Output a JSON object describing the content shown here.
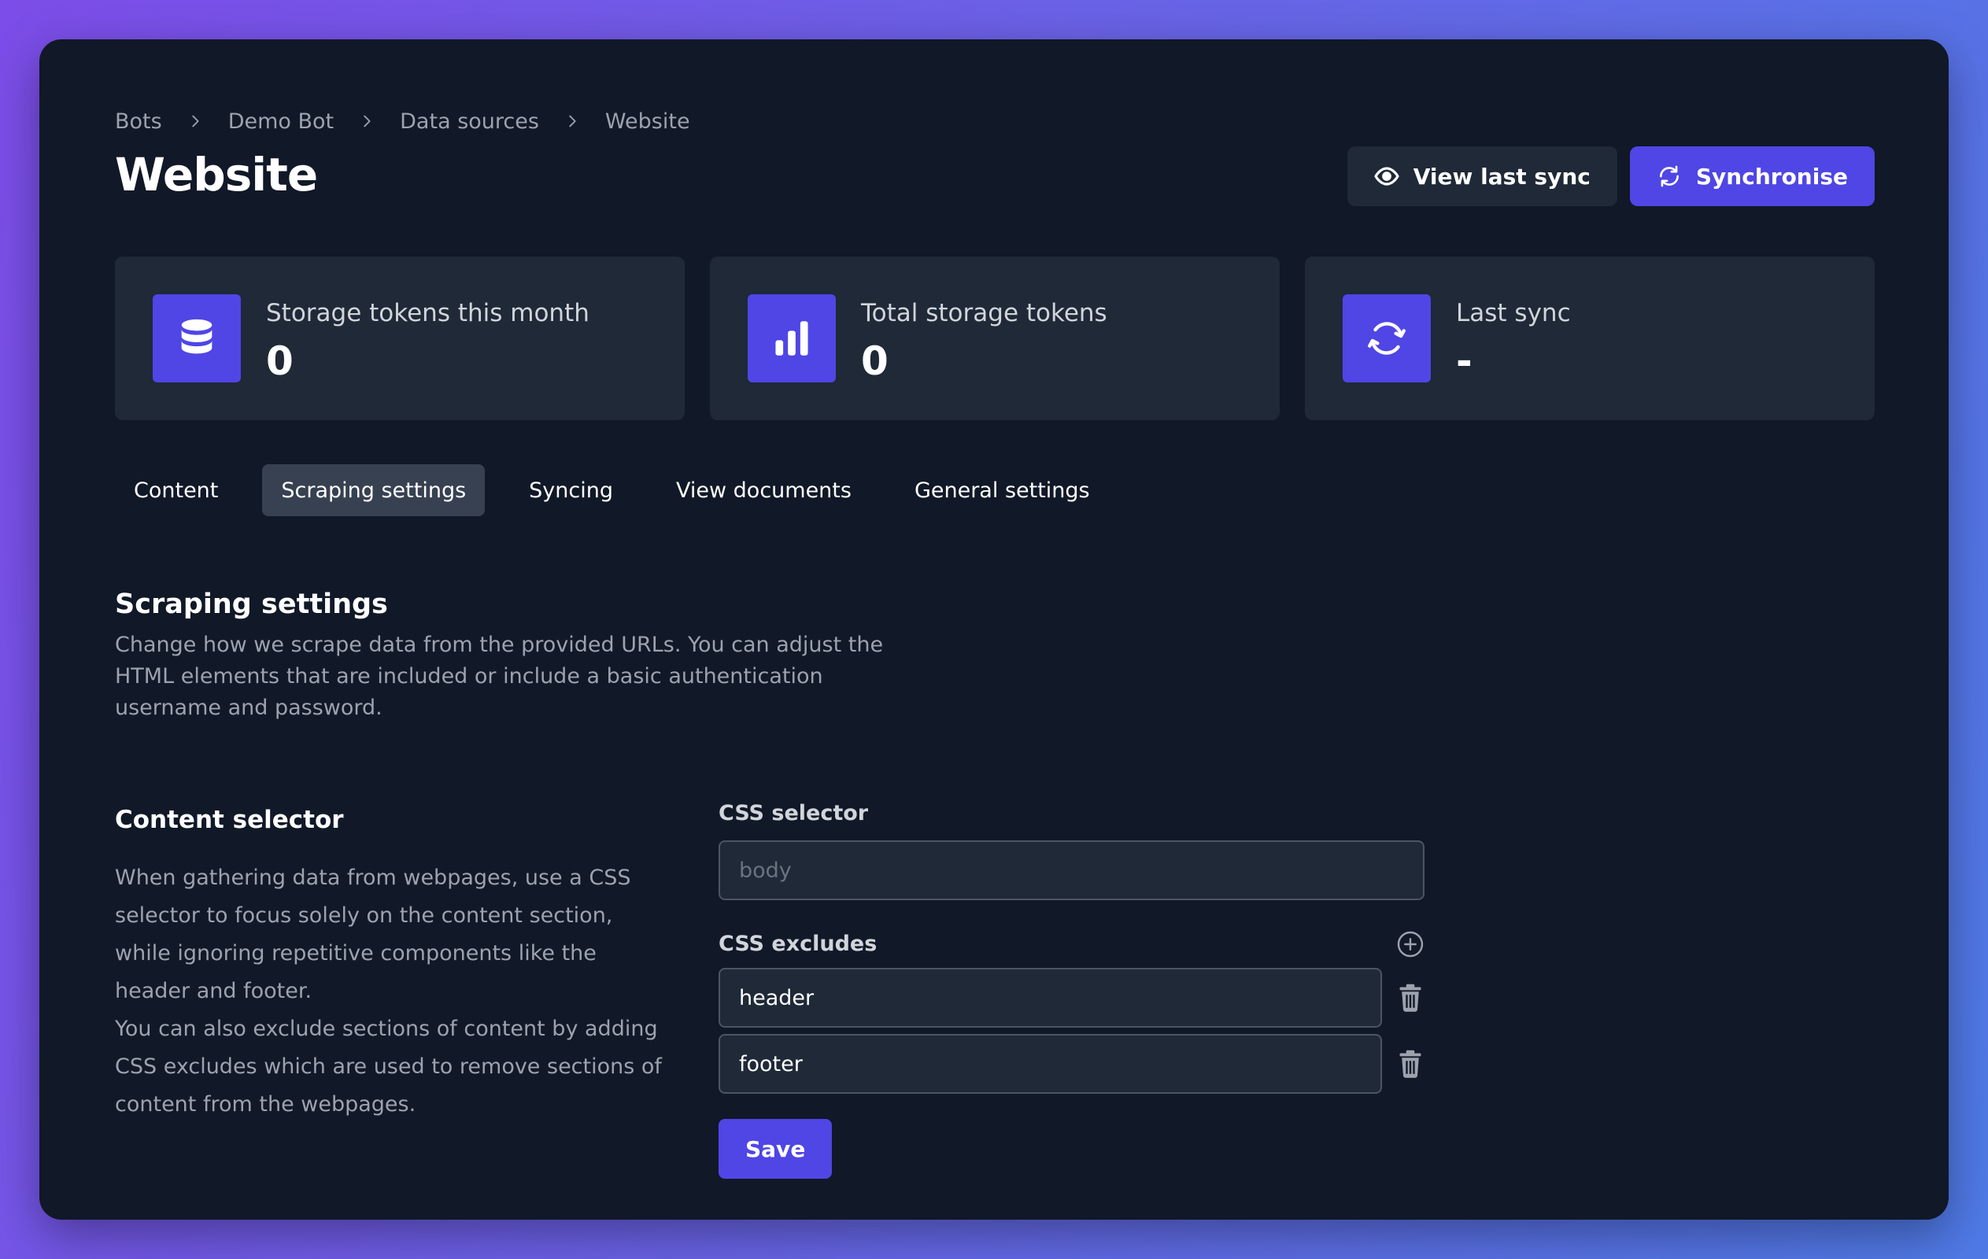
{
  "breadcrumb": {
    "items": [
      "Bots",
      "Demo Bot",
      "Data sources",
      "Website"
    ]
  },
  "page": {
    "title": "Website"
  },
  "header_actions": {
    "view_last_sync": "View last sync",
    "synchronise": "Synchronise"
  },
  "stats": [
    {
      "label": "Storage tokens this month",
      "value": "0",
      "icon": "database-icon"
    },
    {
      "label": "Total storage tokens",
      "value": "0",
      "icon": "bar-chart-icon"
    },
    {
      "label": "Last sync",
      "value": "-",
      "icon": "sync-icon"
    }
  ],
  "tabs": [
    {
      "label": "Content",
      "active": false
    },
    {
      "label": "Scraping settings",
      "active": true
    },
    {
      "label": "Syncing",
      "active": false
    },
    {
      "label": "View documents",
      "active": false
    },
    {
      "label": "General settings",
      "active": false
    }
  ],
  "section": {
    "title": "Scraping settings",
    "description": "Change how we scrape data from the provided URLs. You can adjust the HTML elements that are included or include a basic authentication username and password."
  },
  "content_selector": {
    "title": "Content selector",
    "description_1": "When gathering data from webpages, use a CSS selector to focus solely on the content section, while ignoring repetitive components like the header and footer.",
    "description_2": "You can also exclude sections of content by adding CSS excludes which are used to remove sections of content from the webpages."
  },
  "form": {
    "css_selector_label": "CSS selector",
    "css_selector_value": "",
    "css_selector_placeholder": "body",
    "css_excludes_label": "CSS excludes",
    "excludes": [
      "header",
      "footer"
    ],
    "save_label": "Save"
  },
  "colors": {
    "background": "#111827",
    "card": "#1f2937",
    "accent": "#4f46e5",
    "muted_text": "#9ca3af"
  }
}
